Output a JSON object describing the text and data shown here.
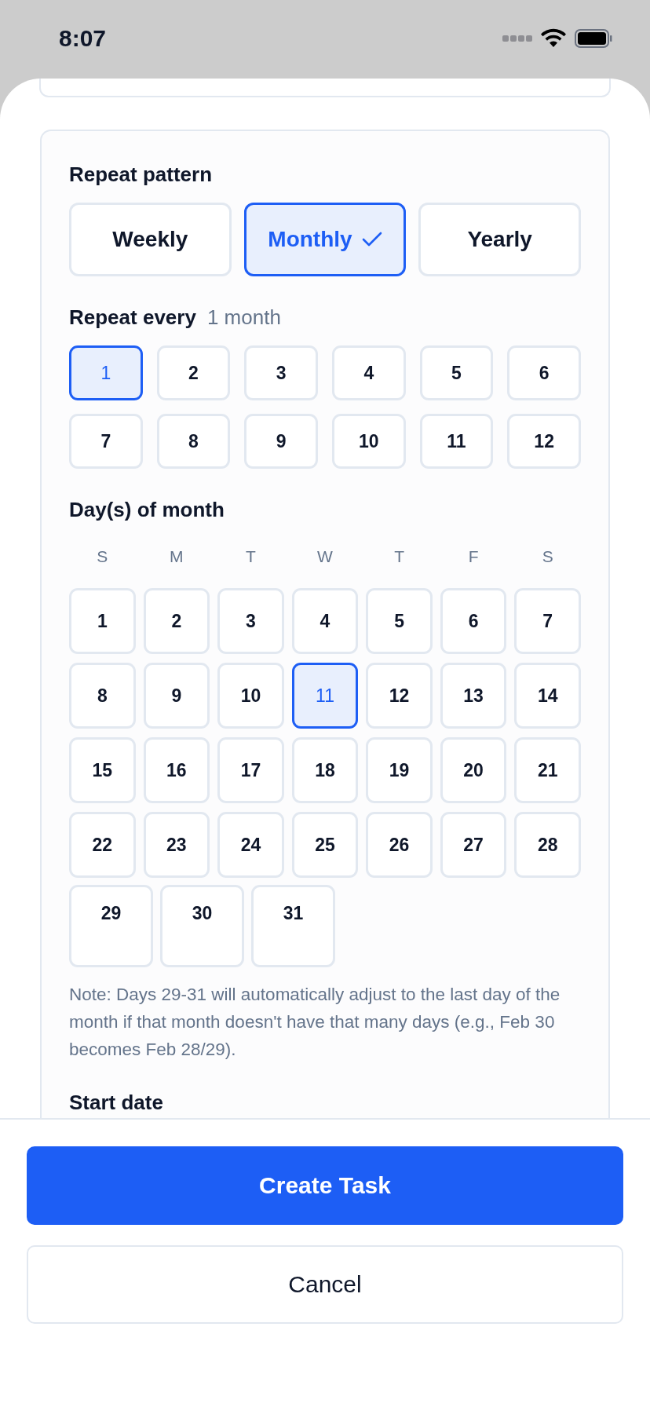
{
  "status_bar": {
    "time": "8:07"
  },
  "repeat_pattern": {
    "label": "Repeat pattern",
    "options": [
      {
        "label": "Weekly",
        "selected": false
      },
      {
        "label": "Monthly",
        "selected": true
      },
      {
        "label": "Yearly",
        "selected": false
      }
    ]
  },
  "repeat_every": {
    "label": "Repeat every",
    "value": "1 month",
    "options": [
      {
        "label": "1",
        "selected": true
      },
      {
        "label": "2",
        "selected": false
      },
      {
        "label": "3",
        "selected": false
      },
      {
        "label": "4",
        "selected": false
      },
      {
        "label": "5",
        "selected": false
      },
      {
        "label": "6",
        "selected": false
      },
      {
        "label": "7",
        "selected": false
      },
      {
        "label": "8",
        "selected": false
      },
      {
        "label": "9",
        "selected": false
      },
      {
        "label": "10",
        "selected": false
      },
      {
        "label": "11",
        "selected": false
      },
      {
        "label": "12",
        "selected": false
      }
    ]
  },
  "days_of_month": {
    "label": "Day(s) of month",
    "weekdays": [
      "S",
      "M",
      "T",
      "W",
      "T",
      "F",
      "S"
    ],
    "days": [
      {
        "label": "1",
        "selected": false
      },
      {
        "label": "2",
        "selected": false
      },
      {
        "label": "3",
        "selected": false
      },
      {
        "label": "4",
        "selected": false
      },
      {
        "label": "5",
        "selected": false
      },
      {
        "label": "6",
        "selected": false
      },
      {
        "label": "7",
        "selected": false
      },
      {
        "label": "8",
        "selected": false
      },
      {
        "label": "9",
        "selected": false
      },
      {
        "label": "10",
        "selected": false
      },
      {
        "label": "11",
        "selected": true
      },
      {
        "label": "12",
        "selected": false
      },
      {
        "label": "13",
        "selected": false
      },
      {
        "label": "14",
        "selected": false
      },
      {
        "label": "15",
        "selected": false
      },
      {
        "label": "16",
        "selected": false
      },
      {
        "label": "17",
        "selected": false
      },
      {
        "label": "18",
        "selected": false
      },
      {
        "label": "19",
        "selected": false
      },
      {
        "label": "20",
        "selected": false
      },
      {
        "label": "21",
        "selected": false
      },
      {
        "label": "22",
        "selected": false
      },
      {
        "label": "23",
        "selected": false
      },
      {
        "label": "24",
        "selected": false
      },
      {
        "label": "25",
        "selected": false
      },
      {
        "label": "26",
        "selected": false
      },
      {
        "label": "27",
        "selected": false
      },
      {
        "label": "28",
        "selected": false
      },
      {
        "label": "29",
        "selected": false
      },
      {
        "label": "30",
        "selected": false
      },
      {
        "label": "31",
        "selected": false
      }
    ]
  },
  "note": "Note: Days 29-31 will automatically adjust to the last day of the month if that month doesn't have that many days (e.g., Feb 30 becomes Feb 28/29).",
  "start_date": {
    "label": "Start date"
  },
  "buttons": [
    {
      "label": "Create Task",
      "kind": "primary"
    },
    {
      "label": "Cancel",
      "kind": "secondary"
    }
  ]
}
